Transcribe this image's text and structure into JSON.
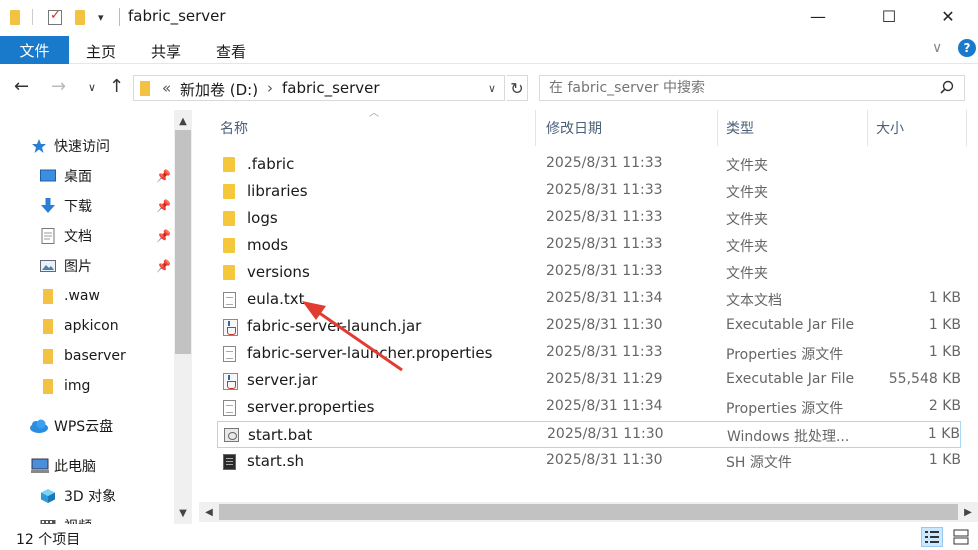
{
  "title": "fabric_server",
  "window": {
    "minimize": "—",
    "maximize": "☐",
    "close": "✕"
  },
  "ribbon": {
    "file": "文件",
    "home": "主页",
    "share": "共享",
    "view": "查看",
    "expand": "∨",
    "help": "?"
  },
  "address": {
    "overflow": "«",
    "drive": "新加卷 (D:)",
    "sep": "›",
    "folder": "fabric_server",
    "dropdown": "∨"
  },
  "search": {
    "placeholder": "在 fabric_server 中搜索"
  },
  "sidebar": {
    "quick_access": "快速访问",
    "items": [
      {
        "label": "桌面",
        "icon": "desktop-icon",
        "pinned": true
      },
      {
        "label": "下载",
        "icon": "download-icon",
        "pinned": true
      },
      {
        "label": "文档",
        "icon": "document-icon",
        "pinned": true
      },
      {
        "label": "图片",
        "icon": "picture-icon",
        "pinned": true
      },
      {
        "label": ".waw",
        "icon": "folder-icon",
        "pinned": false
      },
      {
        "label": "apkicon",
        "icon": "folder-icon",
        "pinned": false
      },
      {
        "label": "baserver",
        "icon": "folder-icon",
        "pinned": false
      },
      {
        "label": "img",
        "icon": "folder-icon",
        "pinned": false
      }
    ],
    "wps": "WPS云盘",
    "this_pc": "此电脑",
    "objects3d": "3D 对象",
    "video": "视频"
  },
  "columns": {
    "name": "名称",
    "date": "修改日期",
    "type": "类型",
    "size": "大小"
  },
  "files": [
    {
      "name": ".fabric",
      "date": "2025/8/31 11:33",
      "type": "文件夹",
      "size": "",
      "icon": "folder"
    },
    {
      "name": "libraries",
      "date": "2025/8/31 11:33",
      "type": "文件夹",
      "size": "",
      "icon": "folder"
    },
    {
      "name": "logs",
      "date": "2025/8/31 11:33",
      "type": "文件夹",
      "size": "",
      "icon": "folder"
    },
    {
      "name": "mods",
      "date": "2025/8/31 11:33",
      "type": "文件夹",
      "size": "",
      "icon": "folder"
    },
    {
      "name": "versions",
      "date": "2025/8/31 11:33",
      "type": "文件夹",
      "size": "",
      "icon": "folder"
    },
    {
      "name": "eula.txt",
      "date": "2025/8/31 11:34",
      "type": "文本文档",
      "size": "1 KB",
      "icon": "doc"
    },
    {
      "name": "fabric-server-launch.jar",
      "date": "2025/8/31 11:30",
      "type": "Executable Jar File",
      "size": "1 KB",
      "icon": "jar"
    },
    {
      "name": "fabric-server-launcher.properties",
      "date": "2025/8/31 11:33",
      "type": "Properties 源文件",
      "size": "1 KB",
      "icon": "doc"
    },
    {
      "name": "server.jar",
      "date": "2025/8/31 11:29",
      "type": "Executable Jar File",
      "size": "55,548 KB",
      "icon": "jar"
    },
    {
      "name": "server.properties",
      "date": "2025/8/31 11:34",
      "type": "Properties 源文件",
      "size": "2 KB",
      "icon": "doc"
    },
    {
      "name": "start.bat",
      "date": "2025/8/31 11:30",
      "type": "Windows 批处理...",
      "size": "1 KB",
      "icon": "bat",
      "selected": true
    },
    {
      "name": "start.sh",
      "date": "2025/8/31 11:30",
      "type": "SH 源文件",
      "size": "1 KB",
      "icon": "sh"
    }
  ],
  "status": {
    "count": "12 个项目"
  },
  "colors": {
    "accent": "#1979ca",
    "annotation_arrow": "#e03c31",
    "selection_border": "#a9d8f5"
  }
}
